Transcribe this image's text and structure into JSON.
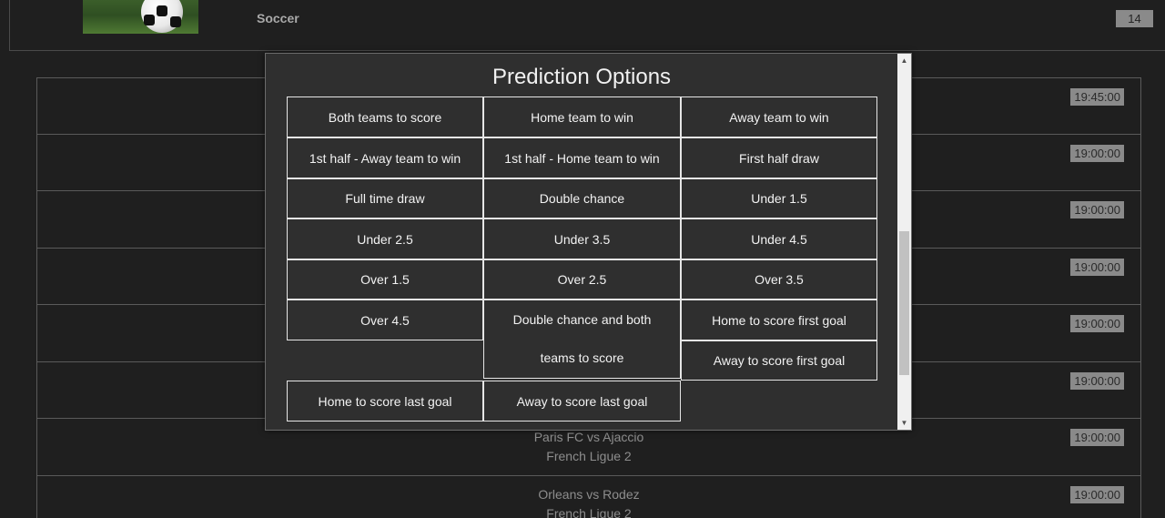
{
  "sport": {
    "name": "Soccer",
    "count": "14"
  },
  "matches": [
    {
      "title": "",
      "league": "",
      "time": "19:45:00"
    },
    {
      "title": "",
      "league": "",
      "time": "19:00:00"
    },
    {
      "title": "",
      "league": "",
      "time": "19:00:00"
    },
    {
      "title": "",
      "league": "",
      "time": "19:00:00"
    },
    {
      "title": "",
      "league": "",
      "time": "19:00:00"
    },
    {
      "title": "",
      "league": "",
      "time": "19:00:00"
    },
    {
      "title": "Paris FC vs Ajaccio",
      "league": "French Ligue 2",
      "time": "19:00:00"
    },
    {
      "title": "Orleans vs Rodez",
      "league": "French Ligue 2",
      "time": "19:00:00"
    }
  ],
  "modal": {
    "title": "Prediction Options",
    "options": [
      "Both teams to score",
      "Home team to win",
      "Away team to win",
      "1st half - Away team to win",
      "1st half - Home team to win",
      "First half draw",
      "Full time draw",
      "Double chance",
      "Under 1.5",
      "Under 2.5",
      "Under 3.5",
      "Under 4.5",
      "Over 1.5",
      "Over 2.5",
      "Over 3.5",
      "Over 4.5",
      "Double chance and both teams to score",
      "Home to score first goal",
      "Away to score first goal",
      "Home to score last goal",
      "Away to score last goal"
    ],
    "tall_option_lines": [
      "Double chance and both",
      "teams to score"
    ]
  }
}
